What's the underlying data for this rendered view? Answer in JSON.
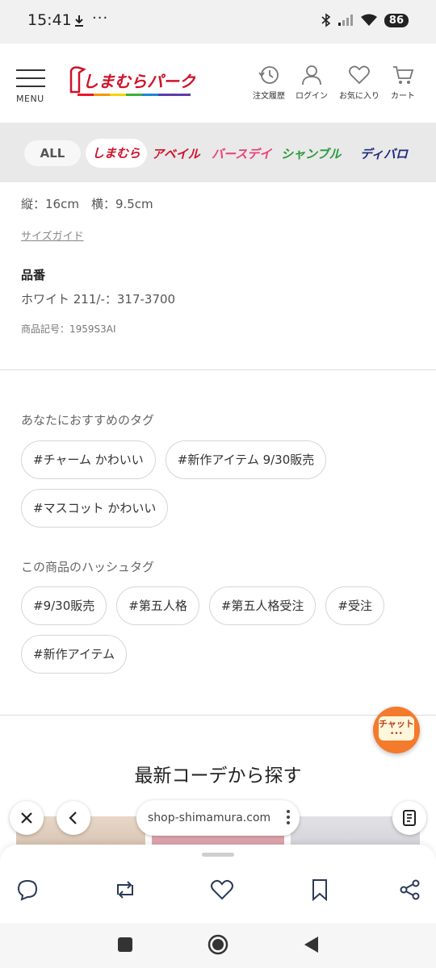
{
  "status_bar": {
    "time": "15:41",
    "more": "···",
    "battery": "86"
  },
  "header": {
    "menu_label": "MENU",
    "logo_text": "しまむらパーク",
    "nav": [
      {
        "label": "注文履歴",
        "icon": "history-icon"
      },
      {
        "label": "ログイン",
        "icon": "user-icon"
      },
      {
        "label": "お気に入り",
        "icon": "heart-icon"
      },
      {
        "label": "カート",
        "icon": "cart-icon"
      }
    ]
  },
  "brands": {
    "all": "ALL",
    "items": [
      {
        "label": "しまむら",
        "color": "#d0112b"
      },
      {
        "label": "アベイル",
        "color": "#d0112b"
      },
      {
        "label": "バースデイ",
        "color": "#e8407a"
      },
      {
        "label": "シャンブル",
        "color": "#2a9a3c"
      },
      {
        "label": "ディバロ",
        "color": "#1e2a7a"
      }
    ]
  },
  "product": {
    "size_text": "縦：16cm　横：9.5cm",
    "size_guide": "サイズガイド",
    "sku_heading": "品番",
    "sku_value": "ホワイト 211/-：317-3700",
    "item_code": "商品記号：1959S3AI"
  },
  "recommended_tags": {
    "title": "あなたにおすすめのタグ",
    "tags": [
      "#チャーム かわいい",
      "#新作アイテム 9/30販売",
      "#マスコット かわいい"
    ]
  },
  "hash_tags": {
    "title": "この商品のハッシュタグ",
    "tags": [
      "#9/30販売",
      "#第五人格",
      "#第五人格受注",
      "#受注",
      "#新作アイテム"
    ]
  },
  "coord_section": {
    "title": "最新コーデから探す"
  },
  "chat": {
    "label": "チャット",
    "dots": "•••"
  },
  "browser": {
    "url": "shop-shimamura.com"
  },
  "colors": {
    "brand_red": "#d0112b",
    "chat_orange": "#f47a2c"
  }
}
